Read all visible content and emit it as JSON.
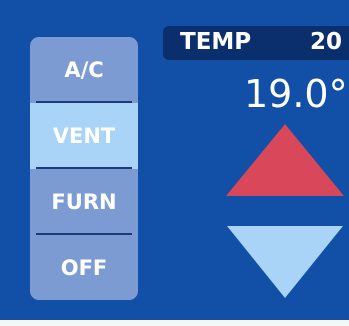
{
  "modes": {
    "items": [
      {
        "label": "A/C"
      },
      {
        "label": "VENT"
      },
      {
        "label": "FURN"
      },
      {
        "label": "OFF"
      }
    ],
    "selected": "VENT"
  },
  "temperature": {
    "header_label": "TEMP",
    "setpoint_partial": "20",
    "current_reading": "19.0°"
  },
  "colors": {
    "background": "#1150a6",
    "mode_button": "#7c9bd3",
    "mode_button_active": "#a9d4f7",
    "header_bar": "#0a2f6c",
    "increase_arrow": "#d9475a",
    "decrease_arrow": "#a9d4f7"
  },
  "icons": {
    "increase": "triangle-up-icon",
    "decrease": "triangle-down-icon"
  }
}
